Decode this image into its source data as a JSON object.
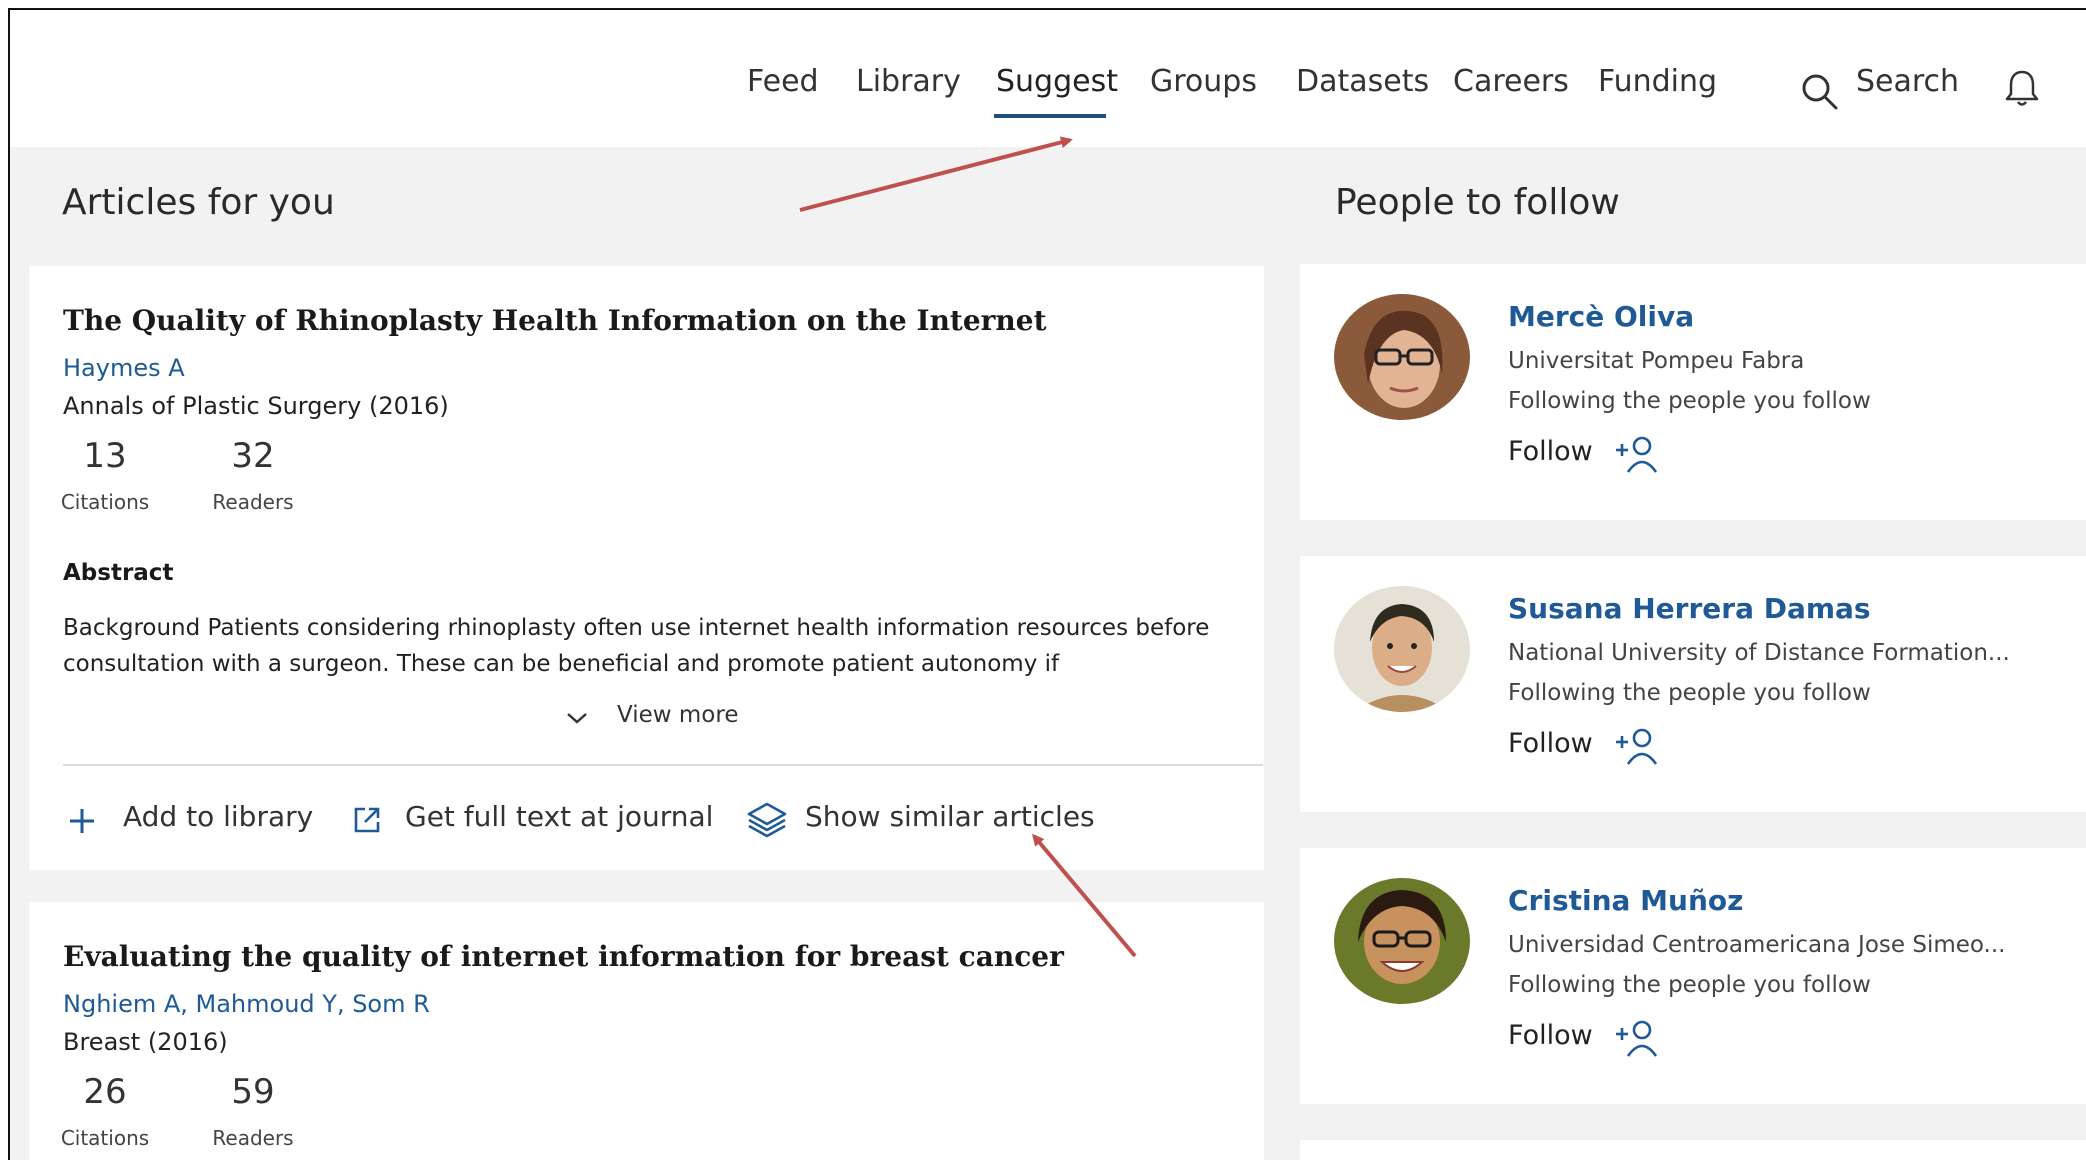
{
  "nav": {
    "items": [
      "Feed",
      "Library",
      "Suggest",
      "Groups",
      "Datasets",
      "Careers",
      "Funding"
    ],
    "active": "Suggest",
    "search_label": "Search"
  },
  "articles_section": {
    "title": "Articles for you"
  },
  "articles": [
    {
      "title": "The Quality of Rhinoplasty Health Information on the Internet",
      "authors": "Haymes A",
      "journal": "Annals of Plastic Surgery (2016)",
      "citations": "13",
      "citations_label": "Citations",
      "readers": "32",
      "readers_label": "Readers",
      "abstract_heading": "Abstract",
      "abstract": "Background Patients considering rhinoplasty often use internet health information resources before consultation with a surgeon. These can be beneficial and promote patient autonomy if",
      "view_more": "View more",
      "actions": {
        "add_to_library": "Add to library",
        "full_text": "Get full text at journal",
        "similar": "Show similar articles"
      }
    },
    {
      "title": "Evaluating the quality of internet information for breast cancer",
      "authors": "Nghiem A, Mahmoud Y, Som R",
      "journal": "Breast (2016)",
      "citations": "26",
      "citations_label": "Citations",
      "readers": "59",
      "readers_label": "Readers"
    }
  ],
  "people_section": {
    "title": "People to follow"
  },
  "people": [
    {
      "name": "Mercè Oliva",
      "institution": "Universitat Pompeu Fabra",
      "reason": "Following the people you follow",
      "follow_label": "Follow"
    },
    {
      "name": "Susana Herrera Damas",
      "institution": "National University of Distance Formation...",
      "reason": "Following the people you follow",
      "follow_label": "Follow"
    },
    {
      "name": "Cristina Muñoz",
      "institution": "Universidad Centroamericana Jose Simeo...",
      "reason": "Following the people you follow",
      "follow_label": "Follow"
    }
  ],
  "colors": {
    "link": "#1f5a96",
    "active_underline": "#1f4f7f",
    "annotation_arrow": "#c0504d",
    "page_bg": "#f2f2f2"
  }
}
